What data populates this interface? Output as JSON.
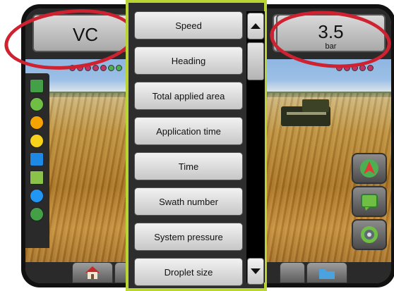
{
  "top_bar": {
    "left_tile": {
      "value": "VC"
    },
    "right_tile": {
      "value": "3.5",
      "unit": "bar"
    }
  },
  "dropdown": {
    "options": [
      "Speed",
      "Heading",
      "Total applied area",
      "Application time",
      "Time",
      "Swath number",
      "System pressure",
      "Droplet size"
    ]
  },
  "colors": {
    "dropdown_border": "#b9d433",
    "annotation_circle": "#cf2230",
    "section_on": "#4caf50",
    "section_off": "#c03468"
  },
  "icons": {
    "scroll_up": "triangle-up",
    "scroll_down": "triangle-down",
    "home": "house-icon",
    "guidance": "arrow-icon",
    "map": "map-icon",
    "camera": "camera-icon"
  }
}
